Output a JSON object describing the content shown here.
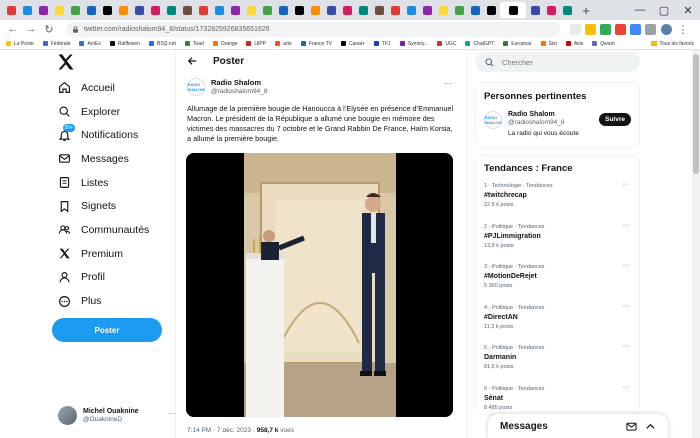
{
  "browser": {
    "url": "twitter.com/radioshalom94_8/status/1732825926835651626",
    "tab_count": 35,
    "bookmarks": [
      {
        "label": "La Poste",
        "color": "#f7c600"
      },
      {
        "label": "Fédérale",
        "color": "#3a6bc4"
      },
      {
        "label": "AmEx",
        "color": "#2e77bb"
      },
      {
        "label": "Raiffeisen",
        "color": "#111111"
      },
      {
        "label": "BSQ.net",
        "color": "#1a73e8"
      },
      {
        "label": "Toad",
        "color": "#2d8a3e"
      },
      {
        "label": "Orange",
        "color": "#ff7900"
      },
      {
        "label": "UIPP",
        "color": "#c62828"
      },
      {
        "label": "arte",
        "color": "#f4511e"
      },
      {
        "label": "France TV",
        "color": "#1565c0"
      },
      {
        "label": "Canal+",
        "color": "#000000"
      },
      {
        "label": "TF1",
        "color": "#0d47a1"
      },
      {
        "label": "Synony...",
        "color": "#7b1fa2"
      },
      {
        "label": "UGC",
        "color": "#d32f2f"
      },
      {
        "label": "ChatGPT",
        "color": "#10a37f"
      },
      {
        "label": "Europcar",
        "color": "#2e7d32"
      },
      {
        "label": "Sixt",
        "color": "#ff6f00"
      },
      {
        "label": "Avis",
        "color": "#d50000"
      },
      {
        "label": "Qwant",
        "color": "#5c6bc0"
      }
    ],
    "all_bookmarks": "Tous les favoris"
  },
  "nav": {
    "items": [
      {
        "label": "Accueil",
        "icon": "home-icon"
      },
      {
        "label": "Explorer",
        "icon": "search-icon"
      },
      {
        "label": "Notifications",
        "icon": "bell-icon",
        "badge": "20+"
      },
      {
        "label": "Messages",
        "icon": "envelope-icon"
      },
      {
        "label": "Listes",
        "icon": "list-icon"
      },
      {
        "label": "Signets",
        "icon": "bookmark-icon"
      },
      {
        "label": "Communautés",
        "icon": "people-icon"
      },
      {
        "label": "Premium",
        "icon": "x-logo-icon"
      },
      {
        "label": "Profil",
        "icon": "person-icon"
      },
      {
        "label": "Plus",
        "icon": "more-circle-icon"
      }
    ],
    "post_button": "Poster",
    "account": {
      "name": "Michel Ouaknine",
      "handle": "@OuaknineD"
    }
  },
  "tweet": {
    "header": "Poster",
    "author_name": "Radio Shalom",
    "author_handle": "@radioshalom94_8",
    "avatar_text": "RADIO SHALOM",
    "text": "Allumage de la première bougie de Hanoucca à l’Elysée en présence d’Emmanuel Macron. Le président de la République a allumé une bougie en mémoire des victimes des massacres du 7 octobre et le Grand Rabbin De France, Haïm Korsia, a allumé la première bougie.",
    "time": "7:14 PM · 7 déc. 2023 · ",
    "views": "958,7 k",
    "views_label": " vues"
  },
  "sidebar": {
    "search_placeholder": "Chercher",
    "relevant_title": "Personnes pertinentes",
    "relevant": {
      "name": "Radio Shalom",
      "handle": "@radioshalom94_8",
      "bio": "La radio qui vous écoute",
      "follow_label": "Suivre"
    },
    "trends_title": "Tendances : France",
    "trends": [
      {
        "context": "1 · Technologie · Tendances",
        "name": "#twitchrecap",
        "count": "22,5 k posts"
      },
      {
        "context": "2 · Politique · Tendances",
        "name": "#PJLimmigration",
        "count": "13,8 k posts"
      },
      {
        "context": "3 · Politique · Tendances",
        "name": "#MotionDeRejet",
        "count": "5 360 posts"
      },
      {
        "context": "4 · Politique · Tendances",
        "name": "#DirectAN",
        "count": "11,2 k posts"
      },
      {
        "context": "5 · Politique · Tendances",
        "name": "Darmanin",
        "count": "81,5 k posts"
      },
      {
        "context": "6 · Politique · Tendances",
        "name": "Sénat",
        "count": "8 495 posts"
      }
    ]
  },
  "messages_drawer": {
    "title": "Messages"
  },
  "colors": {
    "accent": "#1d9bf0",
    "text": "#0f1419",
    "muted": "#536471"
  }
}
